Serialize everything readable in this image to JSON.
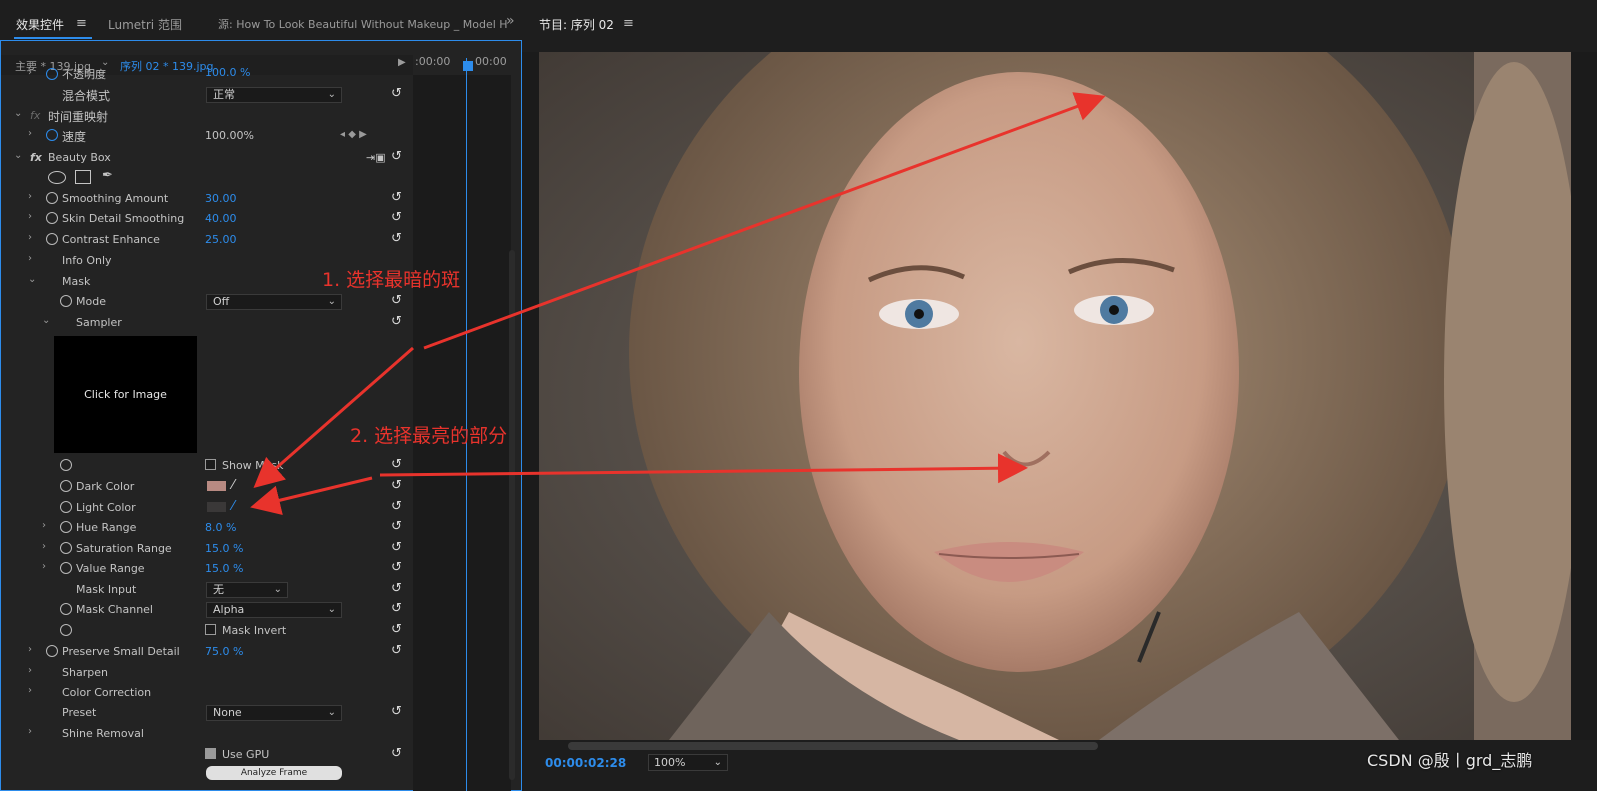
{
  "tabs": {
    "effect_controls": "效果控件",
    "lumetri": "Lumetri 范围",
    "source": "源: How To Look Beautiful Without Makeup _ Model H",
    "overflow": "»"
  },
  "sequence_bar": {
    "master": "主要 * 139.jpg",
    "sequence": "序列 02 * 139.jpg",
    "time_start": ":00:00",
    "time_end": "00:00"
  },
  "effects": {
    "opacity": {
      "label": "不透明度",
      "value": "100.0 %"
    },
    "blend_mode": {
      "label": "混合模式",
      "value": "正常"
    },
    "time_remap": {
      "label": "时间重映射"
    },
    "speed": {
      "label": "速度",
      "value": "100.00%"
    },
    "beauty_box": {
      "label": "Beauty Box"
    },
    "smoothing_amount": {
      "label": "Smoothing Amount",
      "value": "30.00"
    },
    "skin_detail": {
      "label": "Skin Detail Smoothing",
      "value": "40.00"
    },
    "contrast": {
      "label": "Contrast Enhance",
      "value": "25.00"
    },
    "info_only": {
      "label": "Info Only"
    },
    "mask": {
      "label": "Mask"
    },
    "mode": {
      "label": "Mode",
      "value": "Off"
    },
    "sampler": {
      "label": "Sampler",
      "image_text": "Click for Image"
    },
    "show_mask": {
      "label": "Show Mask"
    },
    "dark_color": {
      "label": "Dark Color",
      "swatch": "#b88a82"
    },
    "light_color": {
      "label": "Light Color",
      "swatch": "#3a3838"
    },
    "hue_range": {
      "label": "Hue Range",
      "value": "8.0 %"
    },
    "saturation_range": {
      "label": "Saturation Range",
      "value": "15.0 %"
    },
    "value_range": {
      "label": "Value Range",
      "value": "15.0 %"
    },
    "mask_input": {
      "label": "Mask Input",
      "value": "无"
    },
    "mask_channel": {
      "label": "Mask Channel",
      "value": "Alpha"
    },
    "mask_invert": {
      "label": "Mask Invert"
    },
    "preserve_detail": {
      "label": "Preserve Small Detail",
      "value": "75.0 %"
    },
    "sharpen": {
      "label": "Sharpen"
    },
    "color_correction": {
      "label": "Color Correction"
    },
    "preset": {
      "label": "Preset",
      "value": "None"
    },
    "shine_removal": {
      "label": "Shine Removal"
    },
    "use_gpu": {
      "label": "Use GPU"
    },
    "analyze_frame": {
      "label": "Analyze Frame"
    }
  },
  "program": {
    "title": "节目: 序列 02",
    "timecode": "00:00:02:28",
    "zoom": "100%"
  },
  "annotations": {
    "step1": "1. 选择最暗的斑",
    "step2": "2. 选择最亮的部分"
  },
  "watermark": "CSDN @殷丨grd_志鹏",
  "colors": {
    "accent": "#2d8ceb",
    "annotation": "#e8332c"
  }
}
